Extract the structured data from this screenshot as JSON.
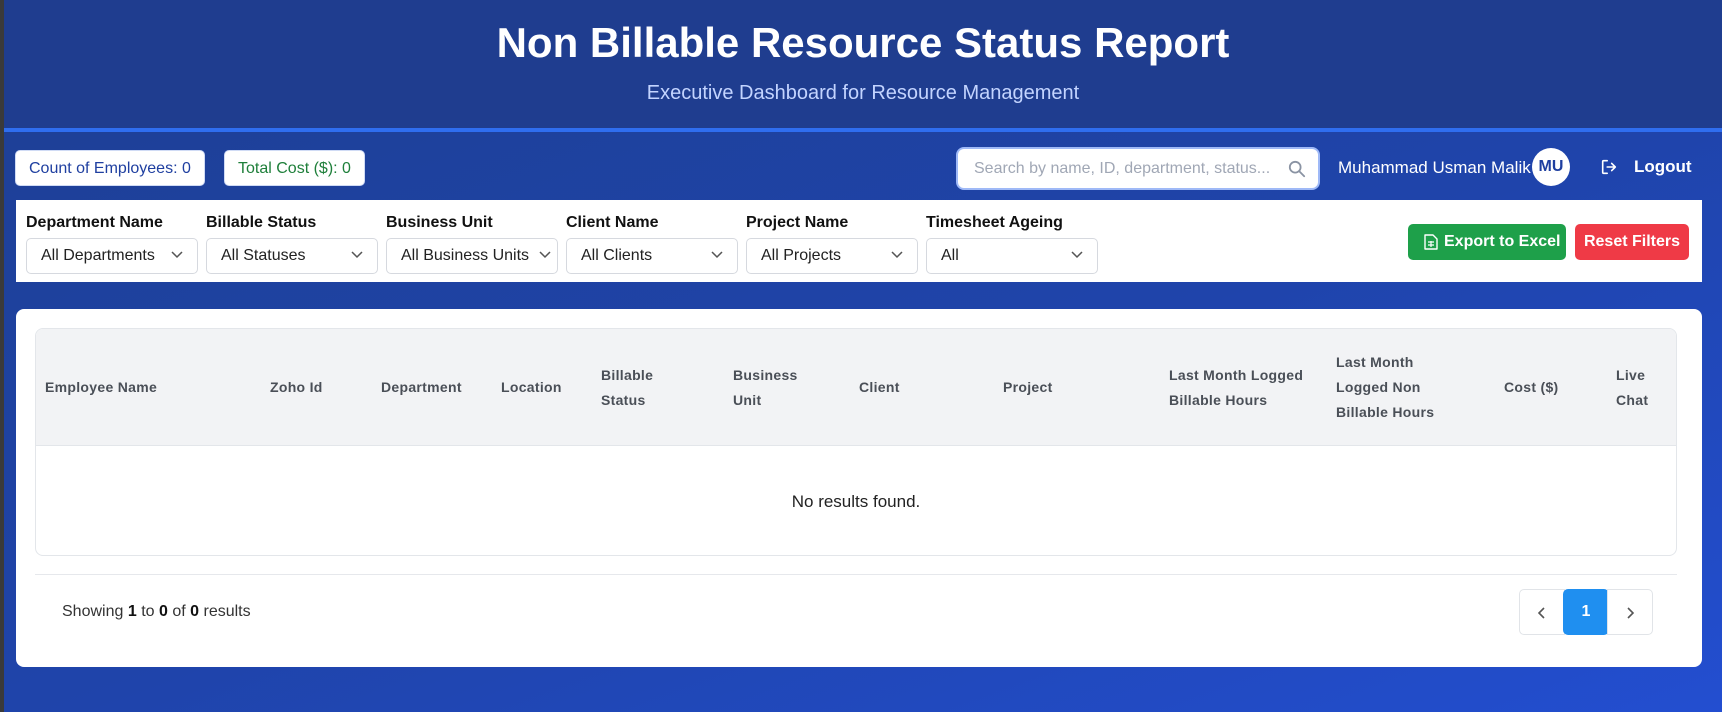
{
  "header": {
    "title": "Non Billable Resource Status Report",
    "subtitle": "Executive Dashboard for Resource Management"
  },
  "stats": {
    "count_label": "Count of Employees: 0",
    "cost_label": "Total Cost ($): 0"
  },
  "search": {
    "placeholder": "Search by name, ID, department, status...",
    "value": ""
  },
  "user": {
    "name": "Muhammad Usman Malik",
    "initials": "MU",
    "logout_label": "Logout"
  },
  "filters": [
    {
      "label": "Department Name",
      "value": "All Departments"
    },
    {
      "label": "Billable Status",
      "value": "All Statuses"
    },
    {
      "label": "Business Unit",
      "value": "All Business Units"
    },
    {
      "label": "Client Name",
      "value": "All Clients"
    },
    {
      "label": "Project Name",
      "value": "All Projects"
    },
    {
      "label": "Timesheet Ageing",
      "value": "All"
    }
  ],
  "actions": {
    "export_label": "Export to Excel",
    "reset_label": "Reset Filters"
  },
  "table": {
    "columns": [
      "Employee Name",
      "Zoho Id",
      "Department",
      "Location",
      "Billable Status",
      "Business Unit",
      "Client",
      "Project",
      "Last Month Logged Billable Hours",
      "Last Month Logged Non Billable Hours",
      "Cost ($)",
      "Live Chat"
    ],
    "rows": [],
    "empty_message": "No results found."
  },
  "pagination": {
    "showing_prefix": "Showing",
    "from": "1",
    "to_word": "to",
    "to": "0",
    "of_word": "of",
    "total": "0",
    "results_word": "results",
    "current_page": "1"
  },
  "colors": {
    "header_bg": "#1f3d8f",
    "accent_blue": "#1f8ff0",
    "export_green": "#1ea04a",
    "reset_red": "#ef3a46"
  }
}
